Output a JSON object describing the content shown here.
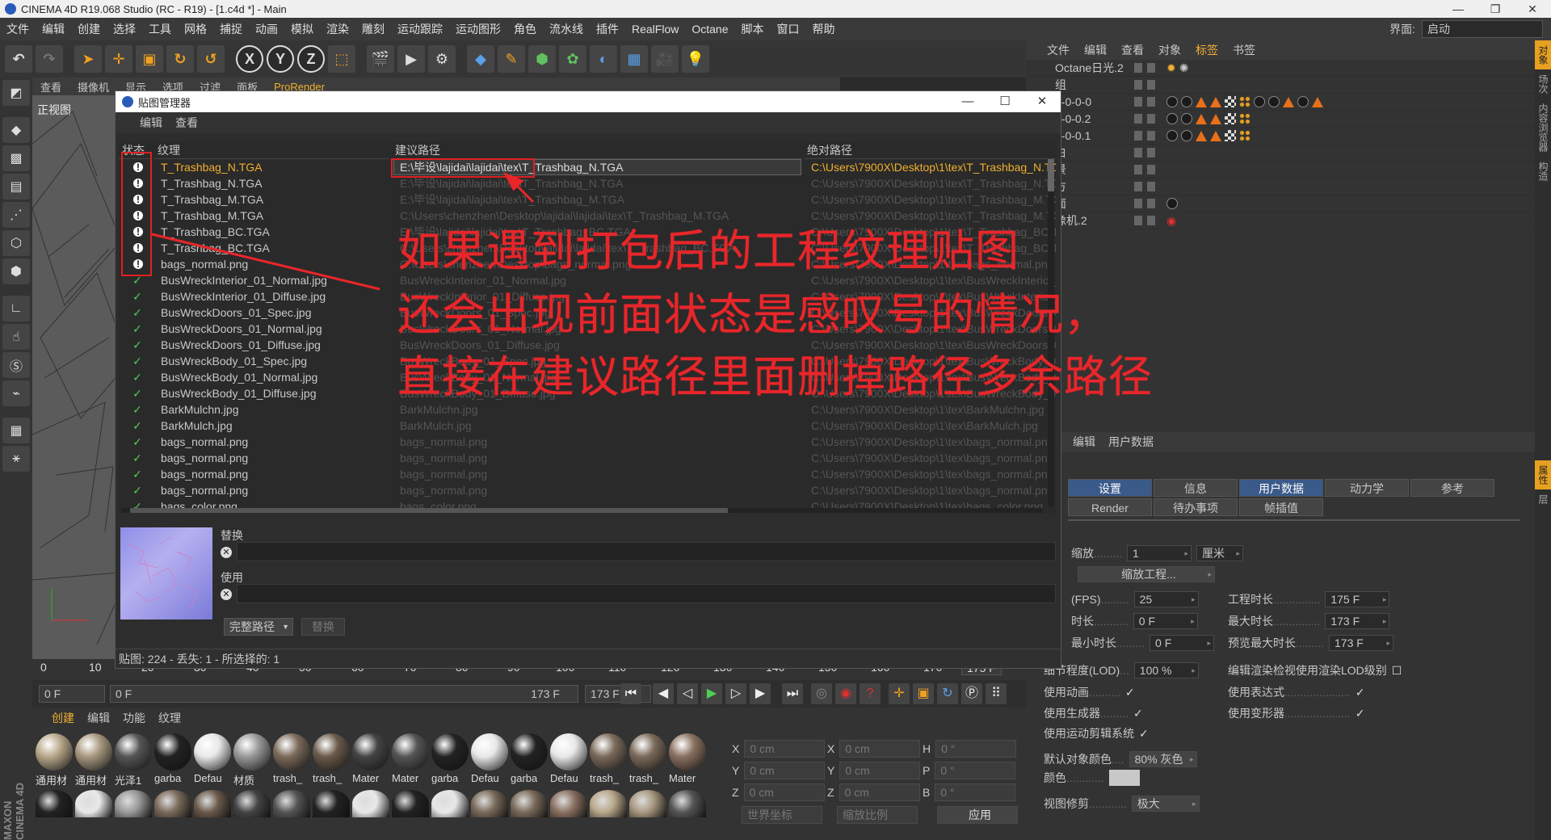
{
  "window": {
    "title": "CINEMA 4D R19.068 Studio (RC - R19) - [1.c4d *] - Main",
    "min": "—",
    "max": "❐",
    "close": "✕"
  },
  "menubar": {
    "items": [
      "文件",
      "编辑",
      "创建",
      "选择",
      "工具",
      "网格",
      "捕捉",
      "动画",
      "模拟",
      "渲染",
      "雕刻",
      "运动跟踪",
      "运动图形",
      "角色",
      "流水线",
      "插件",
      "RealFlow",
      "Octane",
      "脚本",
      "窗口",
      "帮助"
    ],
    "layout_label": "界面:",
    "layout_value": "启动"
  },
  "viewport": {
    "menu": [
      "查看",
      "摄像机",
      "显示",
      "选项",
      "过滤",
      "面板",
      "ProRender"
    ],
    "name": "正视图"
  },
  "texture_manager": {
    "title": "贴图管理器",
    "menu": [
      "编辑",
      "查看"
    ],
    "columns": {
      "status": "状态",
      "texture": "纹理",
      "suggested": "建议路径",
      "absolute": "绝对路径"
    },
    "rows": [
      {
        "status": "warn",
        "texture": "T_Trashbag_N.TGA",
        "suggested": "E:\\毕设\\lajidai\\lajidai\\tex\\T_Trashbag_N.TGA",
        "absolute": "C:\\Users\\7900X\\Desktop\\1\\tex\\T_Trashbag_N.TGA",
        "selected": true
      },
      {
        "status": "warn",
        "texture": "T_Trashbag_N.TGA",
        "suggested": "E:\\毕设\\lajidai\\lajidai\\tex\\T_Trashbag_N.TGA",
        "absolute": "C:\\Users\\7900X\\Desktop\\1\\tex\\T_Trashbag_N.TGA"
      },
      {
        "status": "warn",
        "texture": "T_Trashbag_M.TGA",
        "suggested": "E:\\毕设\\lajidai\\lajidai\\tex\\T_Trashbag_M.TGA",
        "absolute": "C:\\Users\\7900X\\Desktop\\1\\tex\\T_Trashbag_M.TGA"
      },
      {
        "status": "warn",
        "texture": "T_Trashbag_M.TGA",
        "suggested": "C:\\Users\\chenzhen\\Desktop\\lajidai\\lajidai\\tex\\T_Trashbag_M.TGA",
        "absolute": "C:\\Users\\7900X\\Desktop\\1\\tex\\T_Trashbag_M.TGA"
      },
      {
        "status": "warn",
        "texture": "T_Trashbag_BC.TGA",
        "suggested": "E:\\毕设\\lajidai\\lajidai\\tex\\T_Trashbag_BC.TGA",
        "absolute": "C:\\Users\\7900X\\Desktop\\1\\tex\\T_Trashbag_BC.TGA"
      },
      {
        "status": "warn",
        "texture": "T_Trashbag_BC.TGA",
        "suggested": "C:\\Users\\chenzhen\\Desktop\\lajidai\\lajidai\\tex\\T_Trashbag_BC.TGA",
        "absolute": "C:\\Users\\7900X\\Desktop\\1\\tex\\T_Trashbag_BC.TGA"
      },
      {
        "status": "warn",
        "texture": "bags_normal.png",
        "suggested": "C:\\Users\\chenzhen\\Desktop\\bags_normal.png",
        "absolute": "C:\\Users\\7900X\\Desktop\\1\\tex\\bags_normal.png"
      },
      {
        "status": "ok",
        "texture": "BusWreckInterior_01_Normal.jpg",
        "suggested": "BusWreckInterior_01_Normal.jpg",
        "absolute": "C:\\Users\\7900X\\Desktop\\1\\tex\\BusWreckInterior_01_Normal.jpg"
      },
      {
        "status": "ok",
        "texture": "BusWreckInterior_01_Diffuse.jpg",
        "suggested": "BusWreckInterior_01_Diffuse.jpg",
        "absolute": "C:\\Users\\7900X\\Desktop\\1\\tex\\BusWreckInterior_01_Diffuse.jpg"
      },
      {
        "status": "ok",
        "texture": "BusWreckDoors_01_Spec.jpg",
        "suggested": "BusWreckDoors_01_Spec.jpg",
        "absolute": "C:\\Users\\7900X\\Desktop\\1\\tex\\BusWreckDoors_01_Spec.jpg"
      },
      {
        "status": "ok",
        "texture": "BusWreckDoors_01_Normal.jpg",
        "suggested": "BusWreckDoors_01_Normal.jpg",
        "absolute": "C:\\Users\\7900X\\Desktop\\1\\tex\\BusWreckDoors_01_Normal.jpg"
      },
      {
        "status": "ok",
        "texture": "BusWreckDoors_01_Diffuse.jpg",
        "suggested": "BusWreckDoors_01_Diffuse.jpg",
        "absolute": "C:\\Users\\7900X\\Desktop\\1\\tex\\BusWreckDoors_01_Diffuse.jpg"
      },
      {
        "status": "ok",
        "texture": "BusWreckBody_01_Spec.jpg",
        "suggested": "BusWreckBody_01_Spec.jpg",
        "absolute": "C:\\Users\\7900X\\Desktop\\1\\tex\\BusWreckBody_01_Spec.jpg"
      },
      {
        "status": "ok",
        "texture": "BusWreckBody_01_Normal.jpg",
        "suggested": "BusWreckBody_01_Normal.jpg",
        "absolute": "C:\\Users\\7900X\\Desktop\\1\\tex\\BusWreckBody_01_Normal.jpg"
      },
      {
        "status": "ok",
        "texture": "BusWreckBody_01_Diffuse.jpg",
        "suggested": "BusWreckBody_01_Diffuse.jpg",
        "absolute": "C:\\Users\\7900X\\Desktop\\1\\tex\\BusWreckBody_01_Diffuse.jpg"
      },
      {
        "status": "ok",
        "texture": "BarkMulchn.jpg",
        "suggested": "BarkMulchn.jpg",
        "absolute": "C:\\Users\\7900X\\Desktop\\1\\tex\\BarkMulchn.jpg"
      },
      {
        "status": "ok",
        "texture": "BarkMulch.jpg",
        "suggested": "BarkMulch.jpg",
        "absolute": "C:\\Users\\7900X\\Desktop\\1\\tex\\BarkMulch.jpg"
      },
      {
        "status": "ok",
        "texture": "bags_normal.png",
        "suggested": "bags_normal.png",
        "absolute": "C:\\Users\\7900X\\Desktop\\1\\tex\\bags_normal.png"
      },
      {
        "status": "ok",
        "texture": "bags_normal.png",
        "suggested": "bags_normal.png",
        "absolute": "C:\\Users\\7900X\\Desktop\\1\\tex\\bags_normal.png"
      },
      {
        "status": "ok",
        "texture": "bags_normal.png",
        "suggested": "bags_normal.png",
        "absolute": "C:\\Users\\7900X\\Desktop\\1\\tex\\bags_normal.png"
      },
      {
        "status": "ok",
        "texture": "bags_normal.png",
        "suggested": "bags_normal.png",
        "absolute": "C:\\Users\\7900X\\Desktop\\1\\tex\\bags_normal.png"
      },
      {
        "status": "ok",
        "texture": "bags_color.png",
        "suggested": "bags_color.png",
        "absolute": "C:\\Users\\7900X\\Desktop\\1\\tex\\bags_color.png"
      }
    ],
    "replace_label": "替换",
    "use_label": "使用",
    "path_mode": "完整路径",
    "replace_button": "替换",
    "status_text": "贴图: 224 - 丢失: 1 - 所选择的: 1"
  },
  "annotation": {
    "lines": [
      "如果遇到打包后的工程纹理贴图",
      "还会出现前面状态是感叹号的情况，",
      "直接在建议路径里面删掉路径多余路径"
    ],
    "color": "#e8262a"
  },
  "object_manager": {
    "menu": [
      "文件",
      "编辑",
      "查看",
      "对象",
      "标签",
      "书签"
    ],
    "rows": [
      {
        "name": "Octane日光.2"
      },
      {
        "name": "组"
      },
      {
        "name": "0-0-0-0"
      },
      {
        "name": "0-0-0.2"
      },
      {
        "name": "0-0-0.1"
      },
      {
        "name": "白"
      },
      {
        "name": "景"
      },
      {
        "name": "方"
      },
      {
        "name": "面"
      },
      {
        "name": "像机.2"
      }
    ]
  },
  "attributes": {
    "menu": [
      "编辑",
      "用户数据"
    ],
    "tabs": [
      "设置",
      "信息",
      "用户数据",
      "动力学",
      "参考",
      "Render",
      "待办事项",
      "帧插值"
    ],
    "fields": {
      "scale_label": "缩放",
      "scale_value": "1",
      "unit": "厘米",
      "scale_project": "缩放工程...",
      "fps_label": "(FPS)",
      "fps_value": "25",
      "length_label": "工程时长",
      "length_value": "175 F",
      "time_label": "时长",
      "time_value": "0 F",
      "max_label": "最大时长",
      "max_value": "173 F",
      "min_label": "最小时长",
      "min_value": "0 F",
      "preview_max_label": "预览最大时长",
      "preview_max_value": "173 F",
      "lod_label": "细节程度(LOD)",
      "lod_value": "100 %",
      "lod_render_label": "编辑渲染检视使用渲染LOD级别",
      "use_anim": "使用动画",
      "use_expr": "使用表达式",
      "use_gen": "使用生成器",
      "use_deform": "使用变形器",
      "use_motion": "使用运动剪辑系统",
      "default_obj_label": "默认对象颜色",
      "default_obj_value": "80% 灰色",
      "color_label": "颜色",
      "view_clip_label": "视图修剪",
      "view_clip_value": "极大"
    }
  },
  "side_tabs": [
    "对象",
    "场次",
    "内容浏览器",
    "构造",
    "属性",
    "层"
  ],
  "timeline": {
    "ticks": [
      "0",
      "10",
      "20",
      "30",
      "40",
      "50",
      "60",
      "70",
      "80",
      "90",
      "100",
      "110",
      "120",
      "130",
      "140",
      "150",
      "160",
      "170"
    ],
    "current_frame": "175 F",
    "start": "0 F",
    "start2": "0 F",
    "end": "173 F",
    "end2": "173 F"
  },
  "materials": {
    "menu": [
      "创建",
      "编辑",
      "功能",
      "纹理"
    ],
    "labels": [
      "通用材",
      "通用材",
      "光泽1",
      "garba",
      "Defau",
      "材质",
      "trash_",
      "trash_",
      "Mater",
      "Mater",
      "garba",
      "Defau",
      "garba",
      "Defau",
      "trash_",
      "trash_",
      "Mater"
    ]
  },
  "coords": {
    "x": "0 cm",
    "y": "0 cm",
    "z": "0 cm",
    "sx": "0 cm",
    "sy": "0 cm",
    "sz": "0 cm",
    "h": "0 °",
    "p": "0 °",
    "b": "0 °",
    "world": "世界坐标",
    "scale": "缩放比例",
    "apply": "应用"
  },
  "brand": "MAXON CINEMA 4D"
}
